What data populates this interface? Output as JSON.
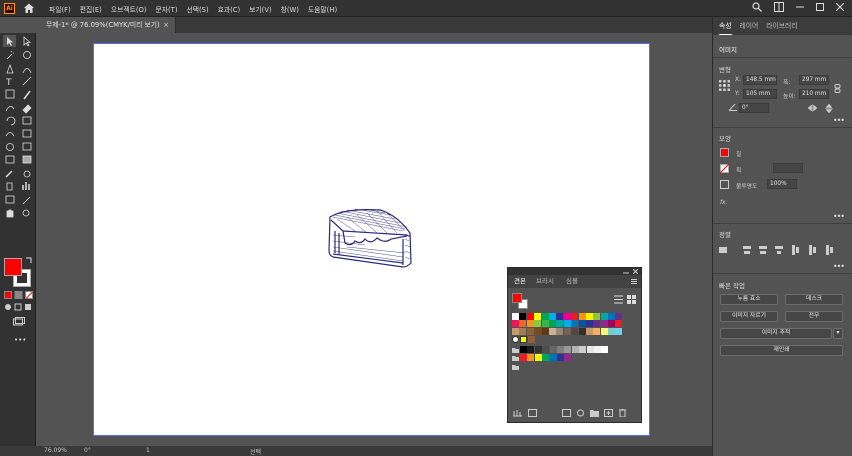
{
  "app": {
    "logo_text": "Ai",
    "brand_color": "#ff9a00"
  },
  "menus": [
    "파일(F)",
    "편집(E)",
    "오브젝트(O)",
    "문자(T)",
    "선택(S)",
    "효과(C)",
    "보기(V)",
    "창(W)",
    "도움말(H)"
  ],
  "document_tab": {
    "title": "무제-1* @ 76.09%(CMYK/미리 보기)",
    "close": "×"
  },
  "status": {
    "zoom": "76.09%",
    "rotate": "0°",
    "artboard_no": "1",
    "tool": "선택"
  },
  "right_panel": {
    "tabs": [
      "속성",
      "레이어",
      "라이브러리"
    ],
    "selection": "이미지",
    "transform": {
      "title": "변형",
      "x_label": "X:",
      "x_value": "148.5 mm",
      "y_label": "Y:",
      "y_value": "105 mm",
      "w_label": "폭:",
      "w_value": "297 mm",
      "h_label": "높이:",
      "h_value": "210 mm",
      "angle": "0°"
    },
    "appearance": {
      "title": "모양",
      "fill_label": "칠",
      "stroke_label": "획",
      "opacity_label": "불투명도",
      "opacity_value": "100%",
      "fx": "fx."
    },
    "align": {
      "title": "정렬"
    },
    "quick_actions": {
      "title": "빠른 작업",
      "buttons": [
        "누름 효소",
        "데스크",
        "이미지 자르기",
        "전무",
        "이미지 추적",
        "재인쇄"
      ]
    },
    "more": "•••"
  },
  "swatches_panel": {
    "tabs": [
      "견본",
      "브러시",
      "심볼"
    ],
    "colors_row1": [
      "#ffffff",
      "#000000",
      "#ff0000",
      "#ffff00",
      "#00a651",
      "#00aeef",
      "#2e3192",
      "#ec008c",
      "#ed1c24",
      "#f7941d",
      "#fff200",
      "#8dc63f",
      "#00a99d",
      "#0072bc",
      "#662d91"
    ],
    "colors_row2": [
      "#ed145b",
      "#f26522",
      "#f7941d",
      "#8dc63f",
      "#39b54a",
      "#00a651",
      "#00a99d",
      "#00aeef",
      "#0072bc",
      "#0054a6",
      "#2e3192",
      "#662d91",
      "#92278f",
      "#9e005d",
      "#ed1c24"
    ],
    "colors_row3": [
      "#c69c6d",
      "#a67c52",
      "#8c6239",
      "#754c24",
      "#603913",
      "#c7b299",
      "#998675",
      "#736357",
      "#534741",
      "#37302a",
      "#c49a6c",
      "#fbaf5d",
      "#fff568",
      "#7accc8",
      "#6dcff6"
    ],
    "grays": [
      "#000000",
      "#1a1a1a",
      "#333333",
      "#4d4d4d",
      "#666666",
      "#808080",
      "#999999",
      "#b3b3b3",
      "#cccccc",
      "#e6e6e6",
      "#f2f2f2",
      "#ffffff"
    ],
    "brights": [
      "#ed1c24",
      "#f7941d",
      "#fff200",
      "#00a651",
      "#0072bc",
      "#2e3192",
      "#92278f"
    ]
  },
  "toolbar": {
    "fill_color": "#ff0000",
    "stroke_color": "#ffffff"
  },
  "artwork": {
    "stroke_color": "#2b2b7a"
  }
}
